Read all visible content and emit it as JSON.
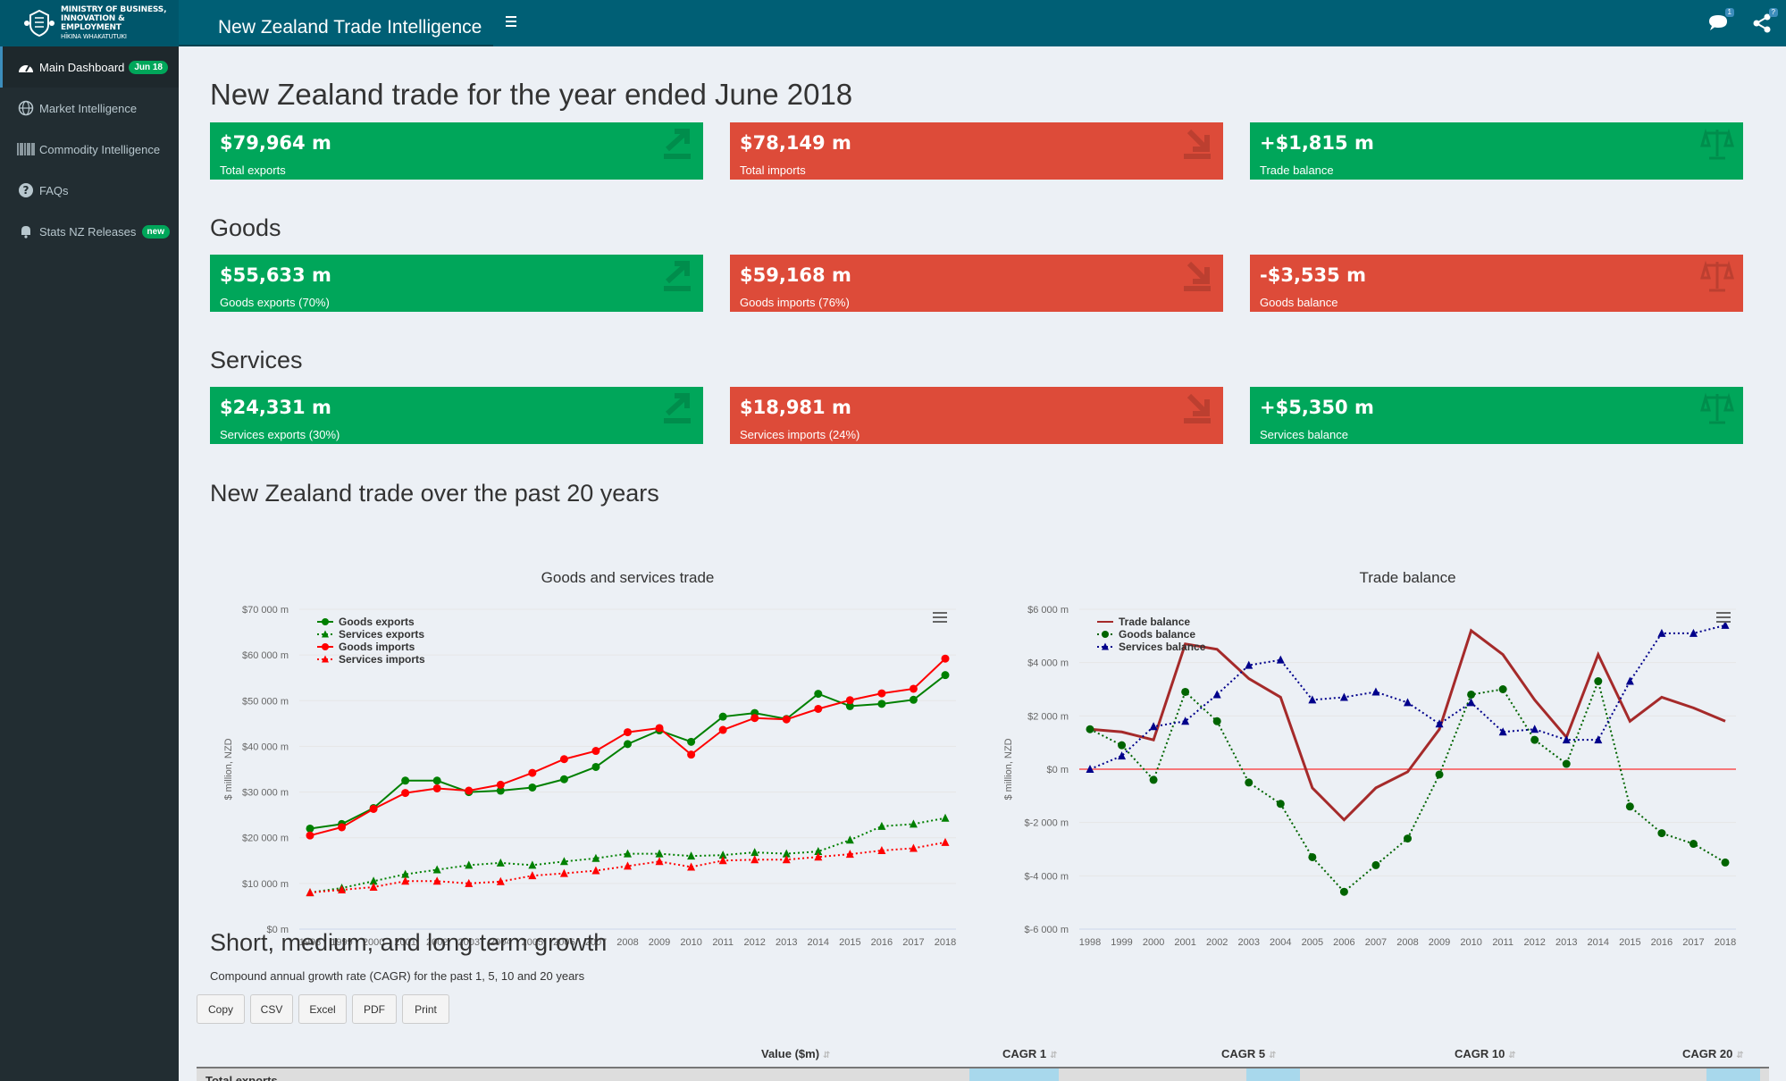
{
  "header": {
    "logo_line1": "MINISTRY OF BUSINESS,",
    "logo_line2": "INNOVATION & EMPLOYMENT",
    "logo_line3": "HĪKINA WHAKATUTUKI",
    "app_title": "New Zealand Trade Intelligence",
    "messages_badge": "1",
    "share_badge": "?"
  },
  "sidebar": {
    "items": [
      {
        "label": "Main Dashboard",
        "badge": "Jun 18",
        "icon": "dashboard-icon"
      },
      {
        "label": "Market Intelligence",
        "icon": "globe-icon"
      },
      {
        "label": "Commodity Intelligence",
        "icon": "barcode-icon"
      },
      {
        "label": "FAQs",
        "icon": "question-circle-icon"
      },
      {
        "label": "Stats NZ Releases",
        "badge": "new",
        "icon": "bell-icon"
      }
    ]
  },
  "main": {
    "title": "New Zealand trade for the year ended June 2018",
    "totals": [
      {
        "value": "$79,964 m",
        "label": "Total exports",
        "color": "#00a65a",
        "icon": "export-arrow-icon"
      },
      {
        "value": "$78,149 m",
        "label": "Total imports",
        "color": "#dd4b39",
        "icon": "import-arrow-icon"
      },
      {
        "value": "+$1,815 m",
        "label": "Trade balance",
        "color": "#00a65a",
        "icon": "balance-scale-icon"
      }
    ],
    "goods_title": "Goods",
    "goods": [
      {
        "value": "$55,633 m",
        "label": "Goods exports (70%)",
        "color": "#00a65a",
        "icon": "export-arrow-icon"
      },
      {
        "value": "$59,168 m",
        "label": "Goods imports (76%)",
        "color": "#dd4b39",
        "icon": "import-arrow-icon"
      },
      {
        "value": "-$3,535 m",
        "label": "Goods balance",
        "color": "#dd4b39",
        "icon": "balance-scale-icon"
      }
    ],
    "services_title": "Services",
    "services": [
      {
        "value": "$24,331 m",
        "label": "Services exports (30%)",
        "color": "#00a65a",
        "icon": "export-arrow-icon"
      },
      {
        "value": "$18,981 m",
        "label": "Services imports (24%)",
        "color": "#dd4b39",
        "icon": "import-arrow-icon"
      },
      {
        "value": "+$5,350 m",
        "label": "Services balance",
        "color": "#00a65a",
        "icon": "balance-scale-icon"
      }
    ],
    "trend_title": "New Zealand trade over the past 20 years",
    "growth_title": "Short, medium, and long term growth",
    "growth_subtitle": "Compound annual growth rate (CAGR) for the past 1, 5, 10 and 20 years",
    "buttons": [
      "Copy",
      "CSV",
      "Excel",
      "PDF",
      "Print"
    ],
    "table_headers": [
      "Value ($m)",
      "CAGR 1",
      "CAGR 5",
      "CAGR 10",
      "CAGR 20"
    ],
    "first_row_label": "Total exports"
  },
  "chart_data": [
    {
      "type": "line",
      "title": "Goods and services trade",
      "ylabel": "$ million, NZD",
      "ylim": [
        0,
        70000
      ],
      "yticks": [
        "$0 m",
        "$10 000 m",
        "$20 000 m",
        "$30 000 m",
        "$40 000 m",
        "$50 000 m",
        "$60 000 m",
        "$70 000 m"
      ],
      "legend_position": "top-left",
      "x": [
        "1998",
        "1999",
        "2000",
        "2001",
        "2002",
        "2003",
        "2004",
        "2005",
        "2006",
        "2007",
        "2008",
        "2009",
        "2010",
        "2011",
        "2012",
        "2013",
        "2014",
        "2015",
        "2016",
        "2017",
        "2018"
      ],
      "series": [
        {
          "name": "Goods exports",
          "color": "#008000",
          "dash": "solid",
          "marker": "circle",
          "values": [
            22000,
            23000,
            26500,
            32500,
            32500,
            30000,
            30300,
            31000,
            32800,
            35500,
            40500,
            43500,
            41000,
            46500,
            47300,
            46000,
            51500,
            48800,
            49300,
            50200,
            55600
          ]
        },
        {
          "name": "Services exports",
          "color": "#008000",
          "dash": "dotted",
          "marker": "triangle",
          "values": [
            8000,
            9000,
            10500,
            12000,
            13000,
            14000,
            14500,
            14000,
            14800,
            15500,
            16500,
            16500,
            16000,
            16200,
            16800,
            16500,
            17000,
            19500,
            22500,
            23000,
            24300
          ]
        },
        {
          "name": "Goods imports",
          "color": "#ff0000",
          "dash": "solid",
          "marker": "circle",
          "values": [
            20500,
            22300,
            26300,
            29800,
            30800,
            30300,
            31600,
            34200,
            37200,
            39000,
            43100,
            44000,
            38200,
            43600,
            46200,
            45900,
            48200,
            50100,
            51600,
            52600,
            59200
          ]
        },
        {
          "name": "Services imports",
          "color": "#ff0000",
          "dash": "dotted",
          "marker": "triangle",
          "values": [
            8000,
            8600,
            9200,
            10500,
            10500,
            10000,
            10400,
            11700,
            12200,
            12800,
            13800,
            14800,
            13600,
            15000,
            15200,
            15200,
            15800,
            16400,
            17200,
            17700,
            19000
          ]
        }
      ]
    },
    {
      "type": "line",
      "title": "Trade balance",
      "ylabel": "$ million, NZD",
      "ylim": [
        -6000,
        6000
      ],
      "yticks": [
        "$-6 000 m",
        "$-4 000 m",
        "$-2 000 m",
        "$0 m",
        "$2 000 m",
        "$4 000 m",
        "$6 000 m"
      ],
      "legend_position": "top-left",
      "x": [
        "1998",
        "1999",
        "2000",
        "2001",
        "2002",
        "2003",
        "2004",
        "2005",
        "2006",
        "2007",
        "2008",
        "2009",
        "2010",
        "2011",
        "2012",
        "2013",
        "2014",
        "2015",
        "2016",
        "2017",
        "2018"
      ],
      "series": [
        {
          "name": "Trade balance",
          "color": "#a52a2a",
          "dash": "solid",
          "marker": "none",
          "values": [
            1500,
            1400,
            1100,
            4700,
            4500,
            3400,
            2700,
            -700,
            -1900,
            -700,
            -100,
            1500,
            5200,
            4300,
            2600,
            1200,
            4300,
            1800,
            2700,
            2300,
            1800
          ]
        },
        {
          "name": "Goods balance",
          "color": "#006400",
          "dash": "dotted",
          "marker": "circle",
          "values": [
            1500,
            900,
            -400,
            2900,
            1800,
            -500,
            -1300,
            -3300,
            -4600,
            -3600,
            -2600,
            -200,
            2800,
            3000,
            1100,
            200,
            3300,
            -1400,
            -2400,
            -2800,
            -3500
          ]
        },
        {
          "name": "Services balance",
          "color": "#00008b",
          "dash": "dotted",
          "marker": "triangle",
          "values": [
            0,
            500,
            1600,
            1800,
            2800,
            3900,
            4100,
            2600,
            2700,
            2900,
            2500,
            1700,
            2500,
            1400,
            1500,
            1100,
            1100,
            3300,
            5100,
            5100,
            5400
          ]
        }
      ]
    }
  ]
}
